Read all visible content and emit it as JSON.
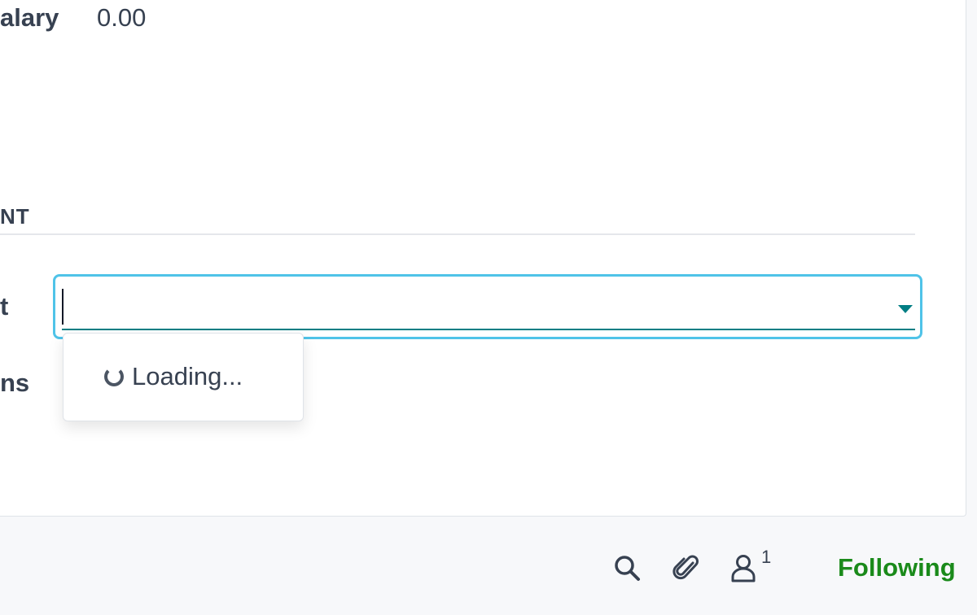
{
  "form": {
    "salary_label": "alary",
    "salary_value": "0.00",
    "section_title": "NT",
    "select_label": "t",
    "second_label": "ns",
    "select_value": ""
  },
  "dropdown": {
    "loading_text": "Loading..."
  },
  "chatter": {
    "follower_count": "1",
    "following_label": "Following"
  },
  "colors": {
    "accent": "#017e84",
    "focus_ring": "#4fc3e8",
    "following": "#1a8a1a"
  },
  "icons": [
    "search-icon",
    "paperclip-icon",
    "user-icon",
    "chevron-down-icon",
    "spinner-icon"
  ]
}
